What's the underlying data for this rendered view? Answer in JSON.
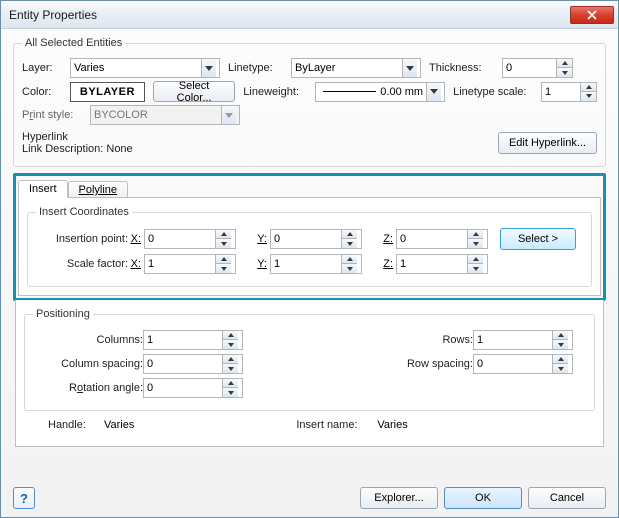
{
  "window": {
    "title": "Entity Properties"
  },
  "group_all": {
    "legend": "All Selected Entities",
    "labels": {
      "layer": "Layer:",
      "linetype": "Linetype:",
      "thickness": "Thickness:",
      "color": "Color:",
      "lineweight": "Lineweight:",
      "linetype_scale": "Linetype scale:"
    },
    "values": {
      "layer": "Varies",
      "linetype": "ByLayer",
      "thickness": "0",
      "color": "BYLAYER",
      "lineweight": "0.00 mm",
      "linetype_scale": "1"
    },
    "buttons": {
      "select_color": "Select Color..."
    },
    "print_style": {
      "label_pre": "P",
      "label_und": "r",
      "label_post": "int style:",
      "value": "BYCOLOR"
    },
    "hyperlink": {
      "label": "Hyperlink",
      "desc": "Link Description: None",
      "button": "Edit Hyperlink..."
    }
  },
  "tabs": {
    "insert": "Insert",
    "polyline": "Polyline"
  },
  "insert_coords": {
    "legend": "Insert Coordinates",
    "labels": {
      "insertion_point": "Insertion point:",
      "scale_factor": "Scale factor:",
      "select": "Select >"
    },
    "axes": {
      "x": "X:",
      "y": "Y:",
      "z": "Z:"
    },
    "values": {
      "ix": "0",
      "iy": "0",
      "iz": "0",
      "sx": "1",
      "sy": "1",
      "sz": "1"
    }
  },
  "positioning": {
    "legend": "Positioning",
    "labels": {
      "columns": "Columns:",
      "rows": "Rows:",
      "col_spacing": "Column spacing:",
      "row_spacing": "Row spacing:",
      "rotation_pre": "R",
      "rotation_und": "o",
      "rotation_post": "tation angle:"
    },
    "values": {
      "columns": "1",
      "rows": "1",
      "col_spacing": "0",
      "row_spacing": "0",
      "rotation": "0"
    }
  },
  "info": {
    "handle_label": "Handle:",
    "handle_value": "Varies",
    "insert_name_label": "Insert name:",
    "insert_name_value": "Varies"
  },
  "footer": {
    "explorer": "Explorer...",
    "ok": "OK",
    "cancel": "Cancel"
  }
}
